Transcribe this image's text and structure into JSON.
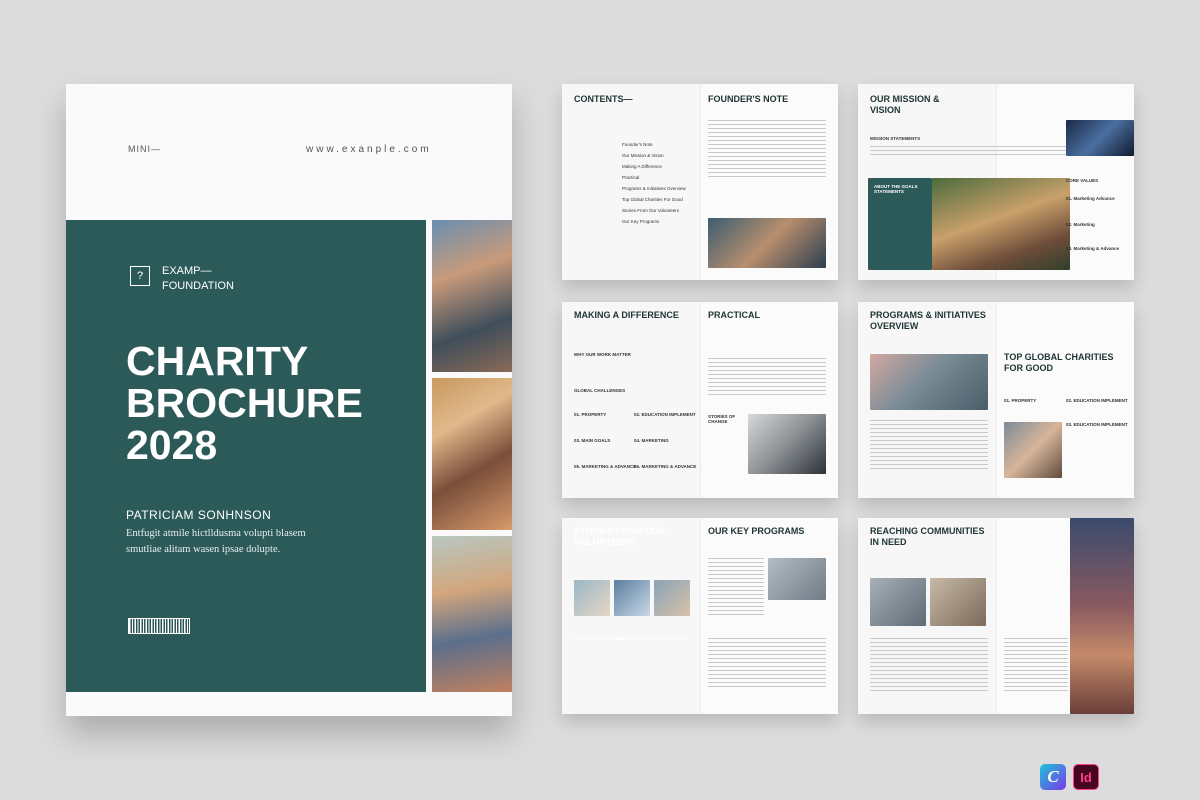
{
  "cover": {
    "mini": "MINI—",
    "url": "www.exanple.com",
    "logo_glyph": "?",
    "org": "EXAMP—\nFOUNDATION",
    "title": "CHARITY\nBROCHURE\n2028",
    "author": "PATRICIAM SONHNSON",
    "desc": "Entfugit atmile hictlldusma volupti blasem smutliae alitam wasen ipsae dolupte."
  },
  "spreads": {
    "s1": {
      "left_title": "CONTENTS—",
      "right_title": "FOUNDER'S NOTE",
      "toc": [
        "Founder's Note",
        "Our Mission & Vision",
        "Making A Difference",
        "Practical",
        "Programs & Initiatives Overview",
        "Top Global Charities For Good",
        "Stories From Our Volunteers",
        "Our Key Programs"
      ]
    },
    "s2": {
      "left_title": "OUR MISSION &\nVISION",
      "sub1": "MISSION STATEMENTS",
      "box": "ABOUT THE GOALS\nSTATEMENTS",
      "core": "CORE VALUES",
      "items": [
        "01. Marketing Advance",
        "02. Marketing",
        "03. Marketing & Advance"
      ]
    },
    "s3": {
      "left_title": "MAKING A DIFFERENCE",
      "right_title": "PRACTICAL",
      "sub1": "WHY OUR WORK MATTER",
      "sub2": "GLOBAL CHALLENGES",
      "items": [
        "01. PROPERTY",
        "02. EDUCATION IMPLEMENT",
        "03. MAIN GOALS",
        "04. MARKETING",
        "05. MARKETING & ADVANCE",
        "06. MARKETING & ADVANCE"
      ],
      "stories": "STORIES OF\nCHANGE"
    },
    "s4": {
      "left_title": "PROGRAMS & INITIATIVES\nOVERVIEW",
      "right_title": "TOP GLOBAL CHARITIES\nFOR GOOD",
      "items": [
        "01. PROPERTY",
        "02. EDUCATION IMPLEMENT",
        "03. EDUCATION IMPLEMENT"
      ]
    },
    "s5": {
      "left_title": "STORIES FROM OUR\nVOLUNTEERS",
      "right_title": "OUR KEY PROGRAMS",
      "names": [
        "PATRICIAM SONHNSON",
        "ROBERT WILLIAM",
        "LINDA BROWN"
      ]
    },
    "s6": {
      "left_title": "REACHING COMMUNITIES\nIN NEED"
    }
  },
  "colors": {
    "accent": "#2c5a59",
    "background": "#dcdcdc"
  },
  "badges": {
    "canva": "C",
    "indesign": "Id"
  }
}
